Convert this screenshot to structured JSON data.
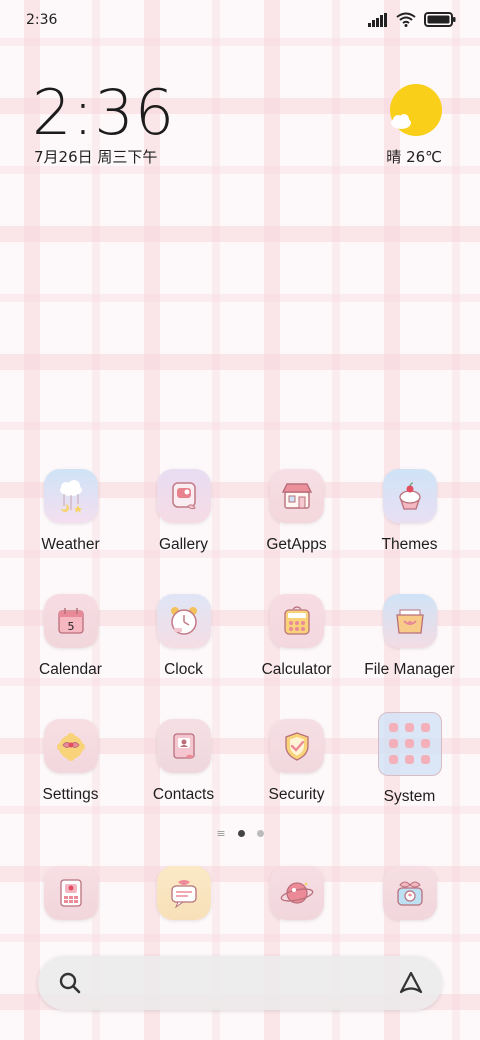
{
  "status_bar": {
    "time": "2:36",
    "icons": [
      "signal-icon",
      "wifi-icon",
      "battery-icon"
    ]
  },
  "clock_widget": {
    "time": "2:36",
    "date": "7月26日 周三下午"
  },
  "weather_widget": {
    "condition_icon": "sun-with-cloud-icon",
    "text": "晴 26℃"
  },
  "apps": [
    {
      "label": "Weather",
      "icon": "weather-icon"
    },
    {
      "label": "Gallery",
      "icon": "gallery-icon"
    },
    {
      "label": "GetApps",
      "icon": "getapps-icon"
    },
    {
      "label": "Themes",
      "icon": "themes-icon"
    },
    {
      "label": "Calendar",
      "icon": "calendar-icon",
      "badge": "5"
    },
    {
      "label": "Clock",
      "icon": "clock-icon"
    },
    {
      "label": "Calculator",
      "icon": "calculator-icon"
    },
    {
      "label": "File Manager",
      "icon": "file-manager-icon"
    },
    {
      "label": "Settings",
      "icon": "settings-icon"
    },
    {
      "label": "Contacts",
      "icon": "contacts-icon"
    },
    {
      "label": "Security",
      "icon": "security-icon"
    },
    {
      "label": "System",
      "icon": "system-folder-icon"
    }
  ],
  "page_indicator": {
    "pages": 2,
    "active": 1
  },
  "dock": [
    {
      "icon": "phone-icon"
    },
    {
      "icon": "messages-icon"
    },
    {
      "icon": "browser-icon"
    },
    {
      "icon": "camera-icon"
    }
  ],
  "search_bar": {
    "placeholder": "",
    "left_icon": "search-icon",
    "right_icon": "assistant-icon"
  },
  "colors": {
    "background": "#fdf8f9",
    "plaid_pink": "#f7d6dc",
    "sun_yellow": "#f9cf1a"
  }
}
